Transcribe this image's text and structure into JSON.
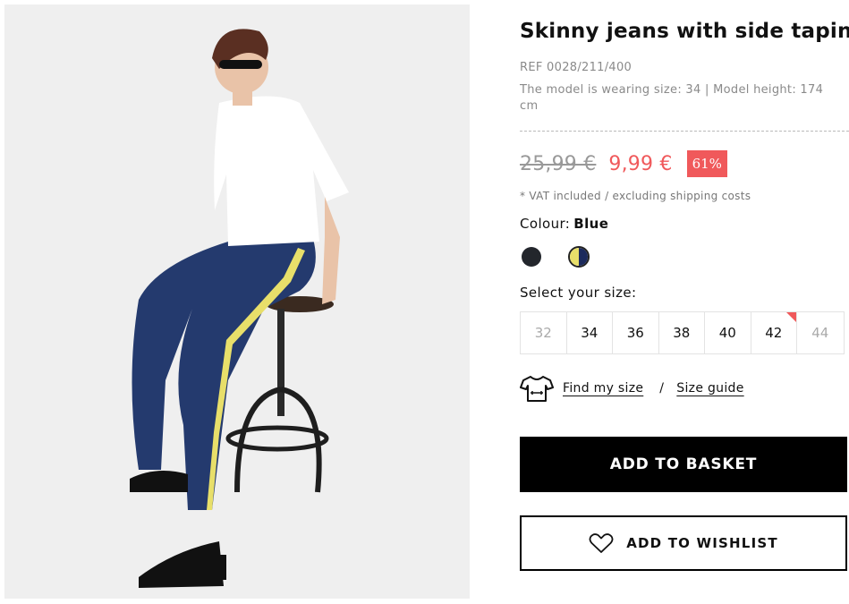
{
  "product": {
    "title": "Skinny jeans with side taping",
    "ref": "REF 0028/211/400",
    "model_info": "The model is wearing size: 34 | Model height: 174 cm",
    "old_price": "25,99 €",
    "new_price": "9,99 €",
    "discount": "61%",
    "vat_note": "* VAT included / excluding shipping costs"
  },
  "colour": {
    "label": "Colour:",
    "value": "Blue",
    "swatches": [
      {
        "name": "black",
        "color": "#23262c"
      },
      {
        "name": "blue",
        "color": "#1c2a5c",
        "accent": "#e8df6a",
        "selected": true
      }
    ]
  },
  "size": {
    "label": "Select your size:",
    "options": [
      {
        "label": "32",
        "available": false
      },
      {
        "label": "34",
        "available": true
      },
      {
        "label": "36",
        "available": true
      },
      {
        "label": "38",
        "available": true
      },
      {
        "label": "40",
        "available": true
      },
      {
        "label": "42",
        "available": true,
        "low_stock": true
      },
      {
        "label": "44",
        "available": false
      }
    ]
  },
  "links": {
    "find_my_size": "Find my size",
    "separator": "/",
    "size_guide": "Size guide"
  },
  "buttons": {
    "add_to_basket": "ADD TO BASKET",
    "add_to_wishlist": "ADD TO WISHLIST"
  },
  "colors": {
    "accent_red": "#f0595b",
    "stripe_yellow": "#e8df6a",
    "denim_blue": "#1c2a5c"
  }
}
